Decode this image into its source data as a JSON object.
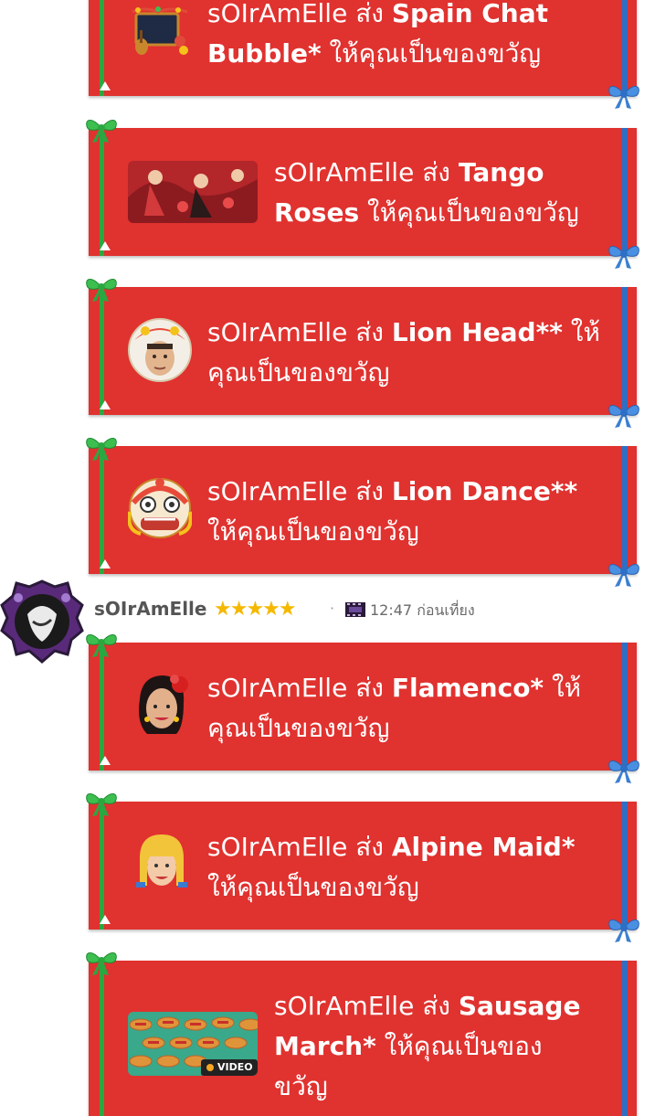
{
  "gifts": [
    {
      "sender": "sOIrAmElle",
      "verb": "ส่ง",
      "item": "Spain Chat Bubble*",
      "suffix": "ให้คุณเป็นของขวัญ",
      "line1a": "sOIrAmElle ส่ง ",
      "line1b": "Spain Chat",
      "line2a": "Bubble*",
      "line2b": " ให้คุณเป็นของขวัญ",
      "line3": "",
      "icon": "spain-chat-bubble-icon"
    },
    {
      "sender": "sOIrAmElle",
      "verb": "ส่ง",
      "item": "Tango Roses",
      "suffix": "ให้คุณเป็นของขวัญ",
      "line1a": "sOIrAmElle ส่ง ",
      "line1b": "Tango",
      "line2a": "Roses",
      "line2b": " ให้คุณเป็นของขวัญ",
      "line3": "",
      "icon": "tango-roses-thumbnail"
    },
    {
      "sender": "sOIrAmElle",
      "verb": "ส่ง",
      "item": "Lion Head**",
      "suffix": "ให้คุณเป็นของขวัญ",
      "line1a": "sOIrAmElle ส่ง ",
      "line1b": "Lion Head**",
      "line1c": " ให้",
      "line2a": "คุณเป็นของขวัญ",
      "line2b": "",
      "line3": "",
      "icon": "lion-head-icon"
    },
    {
      "sender": "sOIrAmElle",
      "verb": "ส่ง",
      "item": "Lion Dance**",
      "suffix": "ให้คุณเป็นของขวัญ",
      "line1a": "sOIrAmElle ส่ง ",
      "line1b": "Lion Dance**",
      "line2a": "ให้คุณเป็นของขวัญ",
      "line2b": "",
      "line3": "",
      "icon": "lion-dance-icon"
    },
    {
      "sender": "sOIrAmElle",
      "verb": "ส่ง",
      "item": "Flamenco*",
      "suffix": "ให้คุณเป็นของขวัญ",
      "line1a": "sOIrAmElle ส่ง ",
      "line1b": "Flamenco*",
      "line1c": " ให้",
      "line2a": "คุณเป็นของขวัญ",
      "line2b": "",
      "line3": "",
      "icon": "flamenco-icon"
    },
    {
      "sender": "sOIrAmElle",
      "verb": "ส่ง",
      "item": "Alpine Maid*",
      "suffix": "ให้คุณเป็นของขวัญ",
      "line1a": "sOIrAmElle ส่ง ",
      "line1b": "Alpine Maid*",
      "line2a": "ให้คุณเป็นของขวัญ",
      "line2b": "",
      "line3": "",
      "icon": "alpine-maid-icon"
    },
    {
      "sender": "sOIrAmElle",
      "verb": "ส่ง",
      "item": "Sausage March*",
      "suffix": "ให้คุณเป็นของขวัญ",
      "line1a": "sOIrAmElle ส่ง ",
      "line1b": "Sausage",
      "line2a": "March*",
      "line2b": " ให้คุณเป็นของ",
      "line3": "ขวัญ",
      "icon": "sausage-march-video-thumbnail",
      "badge": "VIDEO"
    }
  ],
  "message_header": {
    "sender_name": "sOIrAmElle",
    "stars": "★★★★★",
    "separator": "·",
    "time": "12:47 ก่อนเที่ยง",
    "avatar_icon": "user-avatar",
    "film_icon": "film-strip-icon"
  },
  "colors": {
    "card_red": "#e0322f",
    "ribbon_green": "#2aa83f",
    "ribbon_blue": "#2d6fc4",
    "star_gold": "#f5b800"
  }
}
